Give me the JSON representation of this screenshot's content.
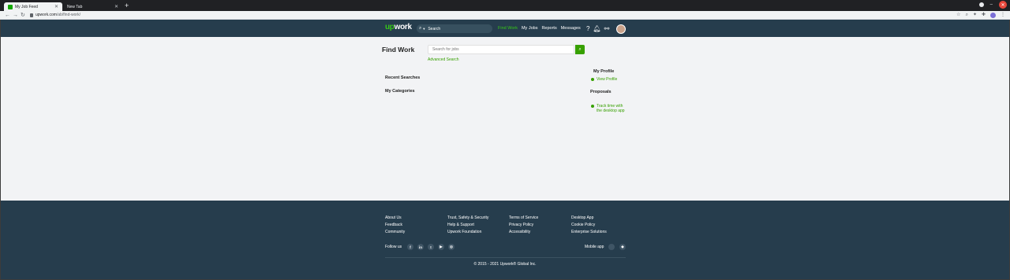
{
  "browser": {
    "tabs": [
      {
        "label": "My Job Feed",
        "active": true
      },
      {
        "label": "New Tab",
        "active": false
      }
    ],
    "new_tab_symbol": "+",
    "url_domain": "upwork.com",
    "url_path": "/ab/find-work/"
  },
  "header": {
    "logo": {
      "up": "up",
      "rest": "work"
    },
    "search_placeholder": "Search",
    "nav": [
      "Find Work",
      "My Jobs",
      "Reports",
      "Messages"
    ],
    "active_nav": "Find Work",
    "accent_color": "#37c818",
    "bg_color": "#263d4d"
  },
  "main": {
    "title": "Find Work",
    "search_placeholder": "Search for jobs",
    "advanced_search": "Advanced Search",
    "recent_searches": "Recent Searches",
    "my_categories": "My Categories"
  },
  "sidebar": {
    "my_profile_title": "My Profile",
    "view_profile": "View Profile",
    "proposals_title": "Proposals",
    "track_time_line1": "Track time with",
    "track_time_line2": "the desktop app"
  },
  "footer": {
    "columns": [
      [
        "About Us",
        "Feedback",
        "Community"
      ],
      [
        "Trust, Safety & Security",
        "Help & Support",
        "Upwork Foundation"
      ],
      [
        "Terms of Service",
        "Privacy Policy",
        "Accessibility"
      ],
      [
        "Desktop App",
        "Cookie Policy",
        "Enterprise Solutions"
      ]
    ],
    "follow_us": "Follow us",
    "social_icons": [
      "facebook-icon",
      "linkedin-icon",
      "twitter-icon",
      "youtube-icon",
      "instagram-icon"
    ],
    "mobile_app": "Mobile app",
    "mobile_icons": [
      "apple-icon",
      "android-icon"
    ],
    "copyright": "© 2015 - 2021 Upwork® Global Inc."
  }
}
